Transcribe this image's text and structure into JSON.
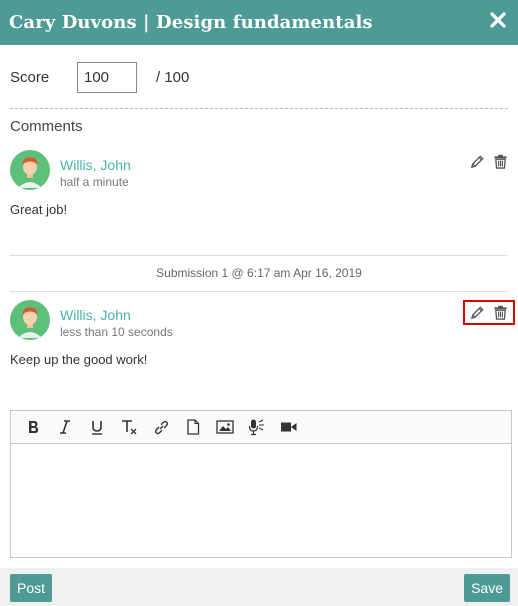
{
  "dialog": {
    "title": "Cary Duvons | Design fundamentals",
    "close_icon": "close-icon"
  },
  "score": {
    "label": "Score",
    "value": "100",
    "max_text": "/ 100"
  },
  "comments": {
    "label": "Comments",
    "items": [
      {
        "author": "Willis, John",
        "time": "half a minute",
        "text": "Great job!",
        "actions_highlighted": false
      },
      {
        "author": "Willis, John",
        "time": "less than 10 seconds",
        "text": "Keep up the good work!",
        "actions_highlighted": true
      }
    ]
  },
  "submission": {
    "text": "Submission 1 @ 6:17 am Apr 16, 2019"
  },
  "editor": {
    "toolbar": [
      "bold-icon",
      "italic-icon",
      "underline-icon",
      "clear-format-icon",
      "link-icon",
      "file-icon",
      "image-icon",
      "microphone-icon",
      "video-icon"
    ],
    "value": ""
  },
  "footer": {
    "post_label": "Post",
    "save_label": "Save"
  },
  "colors": {
    "brand": "#4e9b95",
    "author_link": "#4ab3a8",
    "highlight": "#e00000"
  }
}
